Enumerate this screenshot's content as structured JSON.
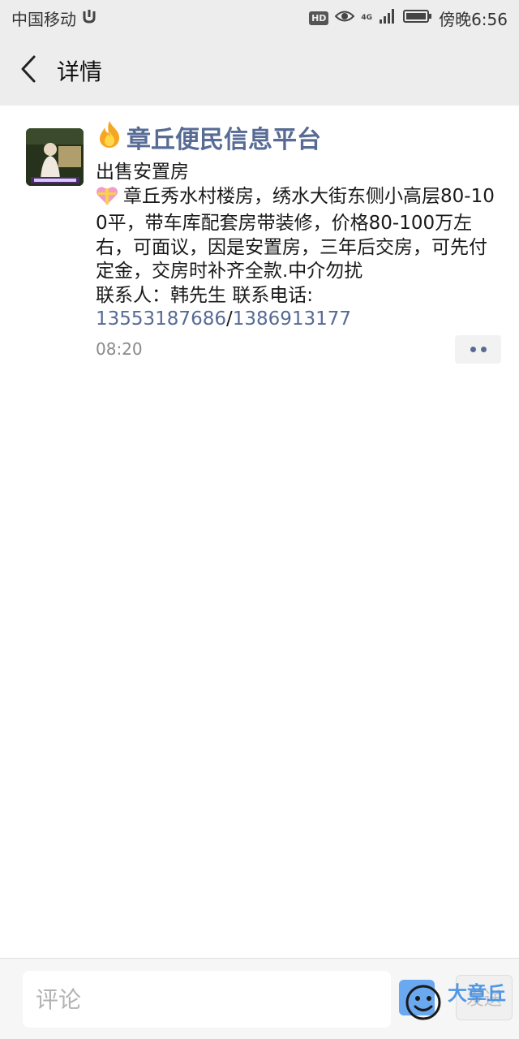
{
  "status_bar": {
    "carrier": "中国移动",
    "hd": "HD",
    "network": "4G",
    "time": "傍晚6:56"
  },
  "header": {
    "title": "详情"
  },
  "post": {
    "nickname": "章丘便民信息平台",
    "lines": [
      "出售安置房",
      "章丘秀水村楼房，绣水大街东侧小高层80-100平，带车库配套房带装修，价格80-100万左右，可面议，因是安置房，三年后交房，可先付定金，交房时补齐全款.中介勿扰",
      "联系人：韩先生  联系电话:"
    ],
    "phone_1": "13553187686",
    "phone_sep": "/",
    "phone_2": "1386913177",
    "time": "08:20"
  },
  "comment_bar": {
    "placeholder": "评论",
    "send_label": "发送"
  },
  "watermark": "大章丘",
  "colors": {
    "link": "#576b95",
    "bar_bg": "#ededed",
    "text": "#191919",
    "muted": "#8a8a8a"
  },
  "icons": [
    "back-arrow-icon",
    "fire-icon",
    "gift-heart-icon",
    "more-dots-icon",
    "emoji-icon",
    "eye-icon",
    "signal-icon",
    "battery-icon"
  ]
}
